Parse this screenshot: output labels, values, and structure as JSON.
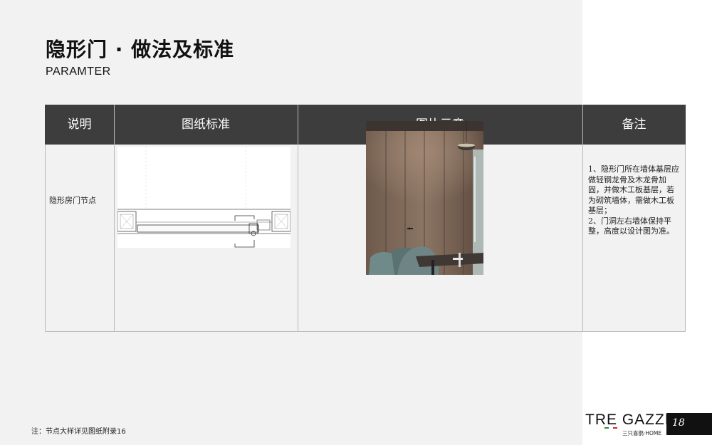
{
  "header": {
    "title": "隐形门 · 做法及标准",
    "subtitle": "PARAMTER"
  },
  "table": {
    "columns": [
      "说明",
      "图纸标准",
      "图片示意",
      "备注"
    ],
    "rows": [
      {
        "label": "隐形房门节点",
        "note": "1、隐形门所在墙体基层应做轻钢龙骨及木龙骨加固，并做木工板基层，若为砌筑墙体，需做木工板基层；\n2、门洞左右墙体保持平整，高度以设计图为准。"
      }
    ]
  },
  "footer": {
    "note": "注：节点大样详见图纸附录16",
    "brand": "TRE GAZZE",
    "brand_sub": "三只喜鹊·HOME",
    "page_number": "18"
  },
  "colors": {
    "background": "#f2f2f2",
    "header_bg": "#3d3d3d",
    "flag_green": "#2e8b3a",
    "flag_red": "#d0282e"
  }
}
